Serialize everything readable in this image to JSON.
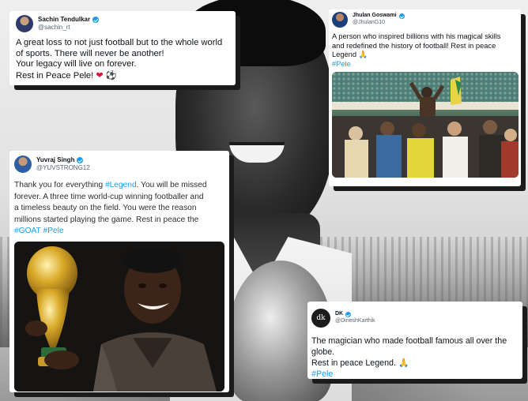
{
  "colors": {
    "link": "#1d9bf0",
    "verified_badge": "#1d9bf0",
    "card_bg": "#ffffff",
    "card_shadow": "#1b1b1b",
    "text": "#0f1419",
    "handle": "#536471",
    "heart": "#d8133c"
  },
  "tweets": {
    "sachin": {
      "name": "Sachin Tendulkar",
      "handle": "@sachin_rt",
      "lines": [
        "A great loss to not just football but to the whole world",
        "of sports. There will never be another!",
        "Your legacy will live on forever.",
        "Rest in Peace Pele! "
      ],
      "emoji": [
        "❤",
        "⚽"
      ]
    },
    "jhulan": {
      "name": "Jhulan Goswami",
      "handle": "@JhulanG10",
      "lines": [
        "A person who inspired billions with his magical skills",
        "and redefined the history of football! Rest in peace",
        "Legend "
      ],
      "emoji": [
        "🙏"
      ],
      "hashtag": "#Pele"
    },
    "yuvraj": {
      "name": "Yuvraj Singh",
      "handle": "@YUVSTRONG12",
      "line1_pre": "Thank you for everything ",
      "line1_tag": "#Legend",
      "line1_post": ". You will be missed",
      "lines": [
        "forever. A three time world-cup winning footballer and",
        "a timeless beauty on the field. You were the reason",
        "millions started playing the game. Rest in peace the"
      ],
      "hashtags": [
        "#GOAT",
        "#Pele"
      ]
    },
    "dk": {
      "avatar_text": "dk",
      "name": "DK",
      "handle": "@DineshKarthik",
      "lines": [
        "The magician who made football famous all over the",
        "globe.",
        "Rest in peace Legend. "
      ],
      "emoji": [
        "🙏"
      ],
      "hashtag": "#Pele"
    }
  },
  "icons": [
    "verified-badge-icon",
    "heart-emoji-icon",
    "football-emoji-icon",
    "folded-hands-emoji-icon"
  ]
}
